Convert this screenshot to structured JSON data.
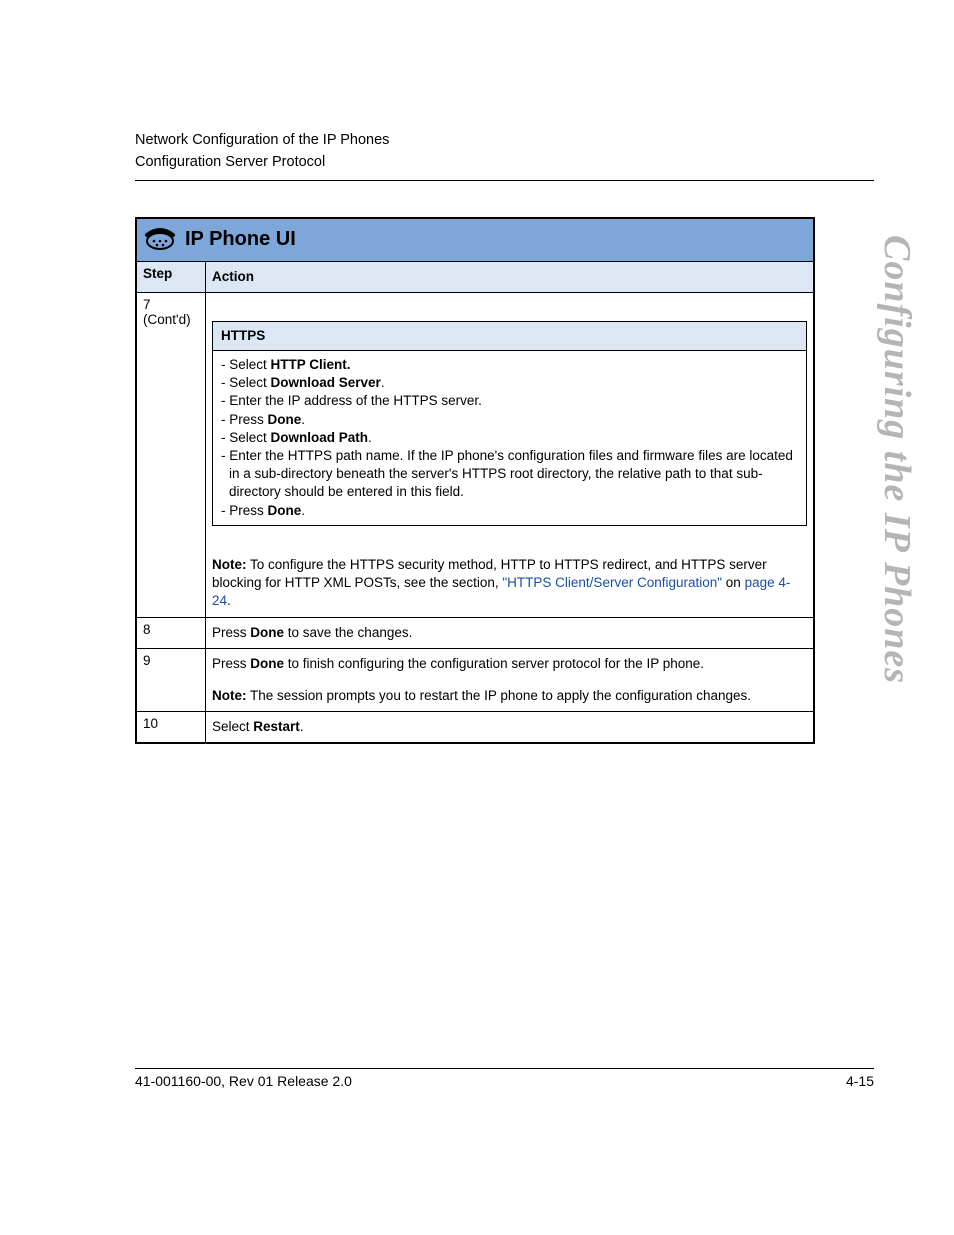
{
  "header": {
    "line1": "Network Configuration of the IP Phones",
    "line2": "Configuration Server Protocol"
  },
  "sideTab": "Configuring the IP Phones",
  "table": {
    "title": "IP Phone UI",
    "head": {
      "step": "Step",
      "action": "Action"
    },
    "row7": {
      "step_num": "7",
      "step_cont": "(Cont'd)",
      "inner_title": "HTTPS",
      "l1a": "- Select ",
      "l1b": "HTTP Client.",
      "l2a": "- Select ",
      "l2b": "Download Server",
      "l2c": ".",
      "l3": "- Enter the IP address of the HTTPS server.",
      "l4a": "- Press ",
      "l4b": "Done",
      "l4c": ".",
      "l5a": "- Select ",
      "l5b": "Download Path",
      "l5c": ".",
      "l6": "- Enter the HTTPS path name. If the IP phone's configuration files and firmware files are located in a sub-directory beneath the server's HTTPS root directory, the relative path to that sub-directory should be entered in this field.",
      "l7a": "- Press ",
      "l7b": "Done",
      "l7c": ".",
      "note_b": "Note:",
      "note_t1": " To configure the HTTPS security method, HTTP to HTTPS redirect, and HTTPS server blocking for HTTP XML POSTs, see the section, ",
      "note_link1": "\"HTTPS Client/Server Configuration\"",
      "note_t2": " on ",
      "note_link2": "page 4-24",
      "note_t3": "."
    },
    "row8": {
      "step": "8",
      "a1": "Press ",
      "a2": "Done",
      "a3": " to save the changes."
    },
    "row9": {
      "step": "9",
      "a1": "Press ",
      "a2": "Done",
      "a3": " to finish configuring the configuration server protocol for the IP phone.",
      "n1": "Note:",
      "n2": " The session prompts you to restart the IP phone to apply the configuration changes."
    },
    "row10": {
      "step": "10",
      "a1": "Select ",
      "a2": "Restart",
      "a3": "."
    }
  },
  "footer": {
    "left": "41-001160-00, Rev 01  Release 2.0",
    "right": "4-15"
  }
}
